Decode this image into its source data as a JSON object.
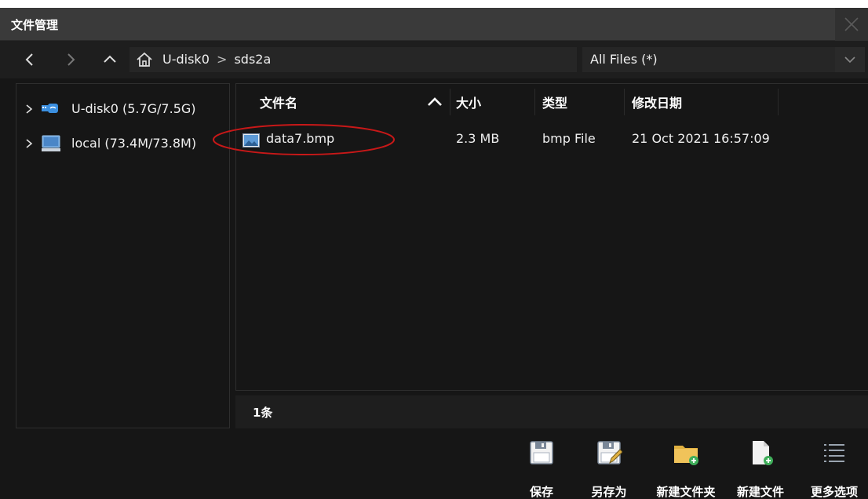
{
  "window": {
    "title": "文件管理"
  },
  "navbar": {
    "path_root": "U-disk0",
    "path_sep": ">",
    "path_folder": "sds2a",
    "filter_value": "All Files (*)"
  },
  "tree": {
    "items": [
      {
        "label": "U-disk0  (5.7G/7.5G)",
        "icon": "usb-drive-icon"
      },
      {
        "label": "local  (73.4M/73.8M)",
        "icon": "local-disk-icon"
      }
    ]
  },
  "filelist": {
    "headers": {
      "name": "文件名",
      "size": "大小",
      "type": "类型",
      "modified": "修改日期"
    },
    "sort": "name-ascending",
    "rows": [
      {
        "name": "data7.bmp",
        "size": "2.3 MB",
        "type": "bmp File",
        "modified": "21 Oct 2021 16:57:09",
        "icon": "image-file-icon"
      }
    ]
  },
  "status": {
    "count_text": "1条"
  },
  "toolbar": {
    "save_label": "保存",
    "save_as_label": "另存为",
    "new_folder_label": "新建文件夹",
    "new_file_label": "新建文件",
    "more_label": "更多选项"
  },
  "colors": {
    "background": "#161616",
    "titlebar": "#3a3a3a",
    "panel": "#1e1e1e",
    "folder_accent": "#e0b040",
    "add_badge": "#3fae5a",
    "usb_accent": "#3b8fe0",
    "highlight_ellipse": "#c81818"
  }
}
